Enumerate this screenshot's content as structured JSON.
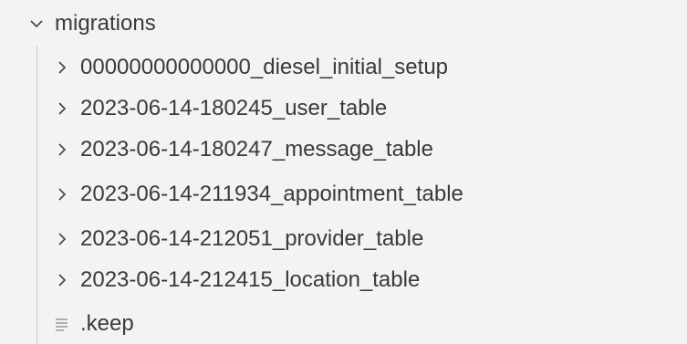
{
  "explorer": {
    "folder": {
      "label": "migrations",
      "expanded": true,
      "icon": "chevron-down-icon"
    },
    "children": [
      {
        "label": "00000000000000_diesel_initial_setup",
        "type": "folder",
        "icon": "chevron-right-icon"
      },
      {
        "label": "2023-06-14-180245_user_table",
        "type": "folder",
        "icon": "chevron-right-icon"
      },
      {
        "label": "2023-06-14-180247_message_table",
        "type": "folder",
        "icon": "chevron-right-icon"
      },
      {
        "label": "2023-06-14-211934_appointment_table",
        "type": "folder",
        "icon": "chevron-right-icon"
      },
      {
        "label": "2023-06-14-212051_provider_table",
        "type": "folder",
        "icon": "chevron-right-icon"
      },
      {
        "label": "2023-06-14-212415_location_table",
        "type": "folder",
        "icon": "chevron-right-icon"
      }
    ],
    "files": [
      {
        "label": ".keep",
        "type": "file",
        "icon": "file-lines-icon"
      }
    ]
  }
}
